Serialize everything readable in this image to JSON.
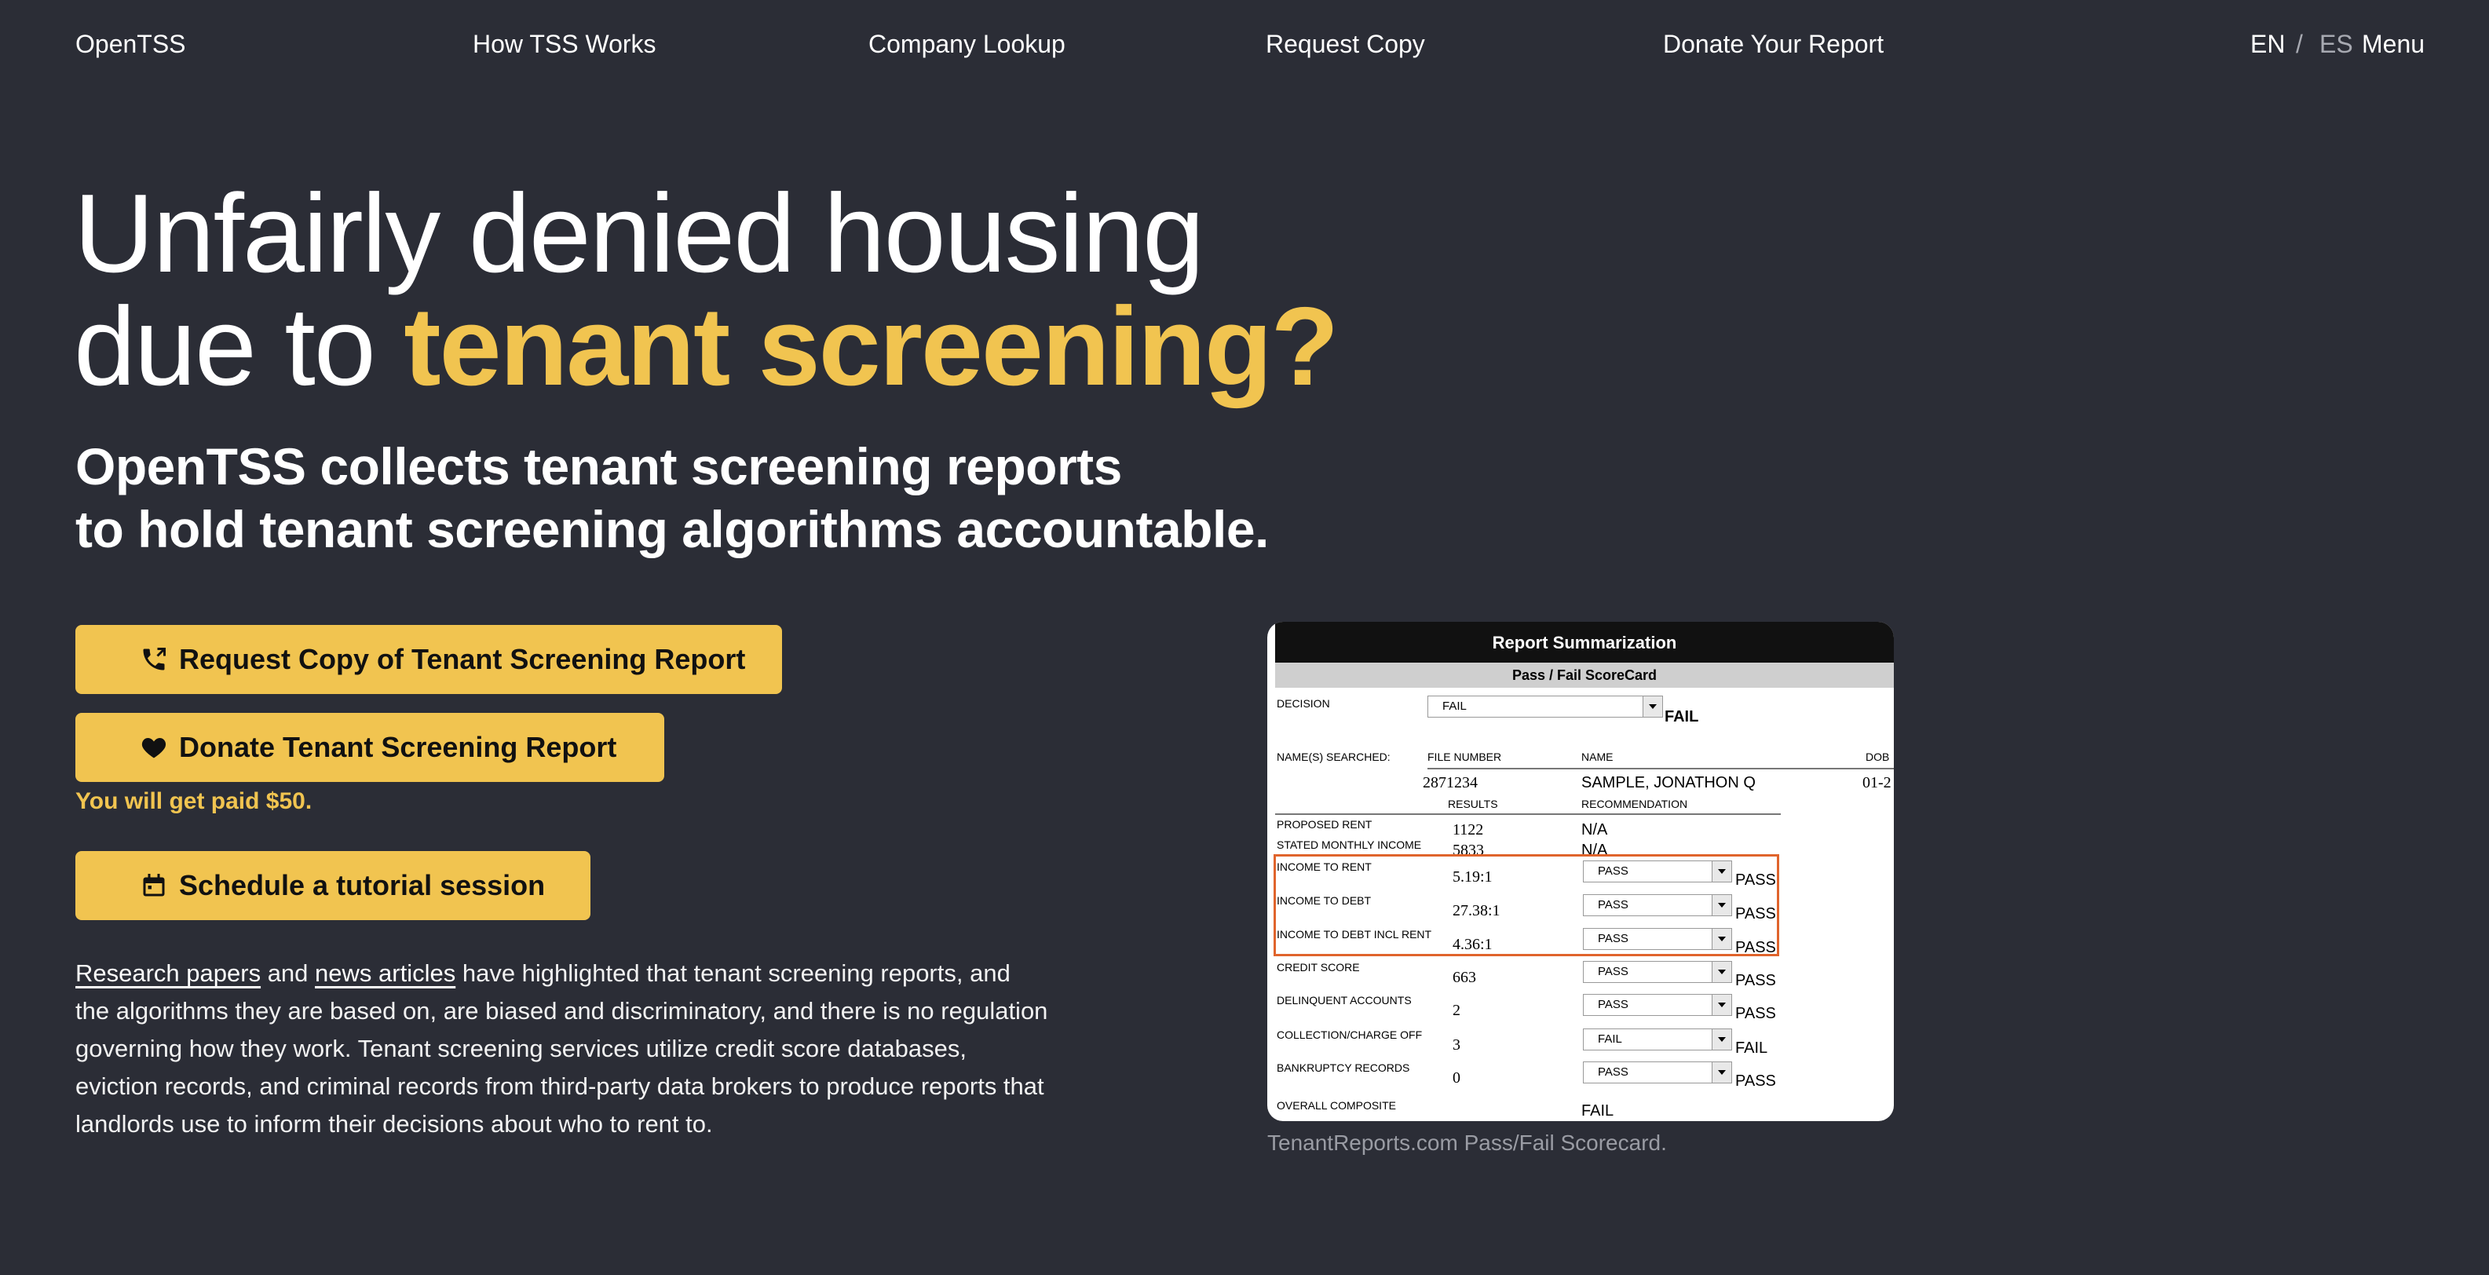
{
  "nav": {
    "logo": "OpenTSS",
    "how": "How TSS Works",
    "lookup": "Company Lookup",
    "request": "Request Copy",
    "donate": "Donate Your Report",
    "lang_en": "EN",
    "lang_sep": "/",
    "lang_es": "ES",
    "menu": "Menu"
  },
  "hero": {
    "title_line1": "Unfairly denied housing",
    "title_line2_prefix": "due to ",
    "title_accent": "tenant screening?",
    "subtitle_line1": "OpenTSS collects tenant screening reports",
    "subtitle_line2": "to hold tenant screening algorithms accountable."
  },
  "actions": {
    "request_label": "Request Copy of Tenant Screening Report",
    "request_icon": "phone-icon",
    "donate_label": "Donate Tenant Screening Report",
    "donate_icon": "heart-icon",
    "paid_note": "You will get paid $50.",
    "tutorial_label": "Schedule a tutorial session",
    "tutorial_icon": "calendar-icon"
  },
  "body": {
    "link_papers": "Research papers",
    "and": " and ",
    "link_news": "news articles",
    "rest": " have highlighted that tenant screening reports, and the algorithms they are based on, are biased and discriminatory, and there is no regulation governing how they work. Tenant screening services utilize credit score databases, eviction records, and criminal records from third-party data brokers to produce reports that landlords use to inform their decisions about who to rent to."
  },
  "scorecard": {
    "header": "Report Summarization",
    "subheader": "Pass / Fail ScoreCard",
    "decision_label": "DECISION",
    "decision_value": "FAIL",
    "decision_result": "FAIL",
    "names_label": "NAME(S) SEARCHED:",
    "file_label": "FILE NUMBER",
    "name_label": "NAME",
    "dob_label": "DOB",
    "file_number": "2871234",
    "name_value": "SAMPLE, JONATHON Q",
    "dob_value": "01-2",
    "results_label": "RESULTS",
    "recommendation_label": "RECOMMENDATION",
    "rows": [
      {
        "label": "PROPOSED RENT",
        "value": "1122",
        "rec": "N/A"
      },
      {
        "label": "STATED MONTHLY INCOME",
        "value": "5833",
        "rec": "N/A"
      },
      {
        "label": "INCOME TO RENT",
        "value": "5.19:1",
        "select": "PASS",
        "result": "PASS"
      },
      {
        "label": "INCOME TO DEBT",
        "value": "27.38:1",
        "select": "PASS",
        "result": "PASS"
      },
      {
        "label": "INCOME TO DEBT INCL RENT",
        "value": "4.36:1",
        "select": "PASS",
        "result": "PASS"
      },
      {
        "label": "CREDIT SCORE",
        "value": "663",
        "select": "PASS",
        "result": "PASS"
      },
      {
        "label": "DELINQUENT ACCOUNTS",
        "value": "2",
        "select": "PASS",
        "result": "PASS"
      },
      {
        "label": "COLLECTION/CHARGE OFF",
        "value": "3",
        "select": "FAIL",
        "result": "FAIL"
      },
      {
        "label": "BANKRUPTCY RECORDS",
        "value": "0",
        "select": "PASS",
        "result": "PASS"
      },
      {
        "label": "OVERALL COMPOSITE",
        "rec": "FAIL"
      }
    ],
    "highlight_color": "#e0642c",
    "caption": "TenantReports.com Pass/Fail Scorecard."
  },
  "colors": {
    "background": "#2b2d36",
    "accent": "#f1c450"
  }
}
